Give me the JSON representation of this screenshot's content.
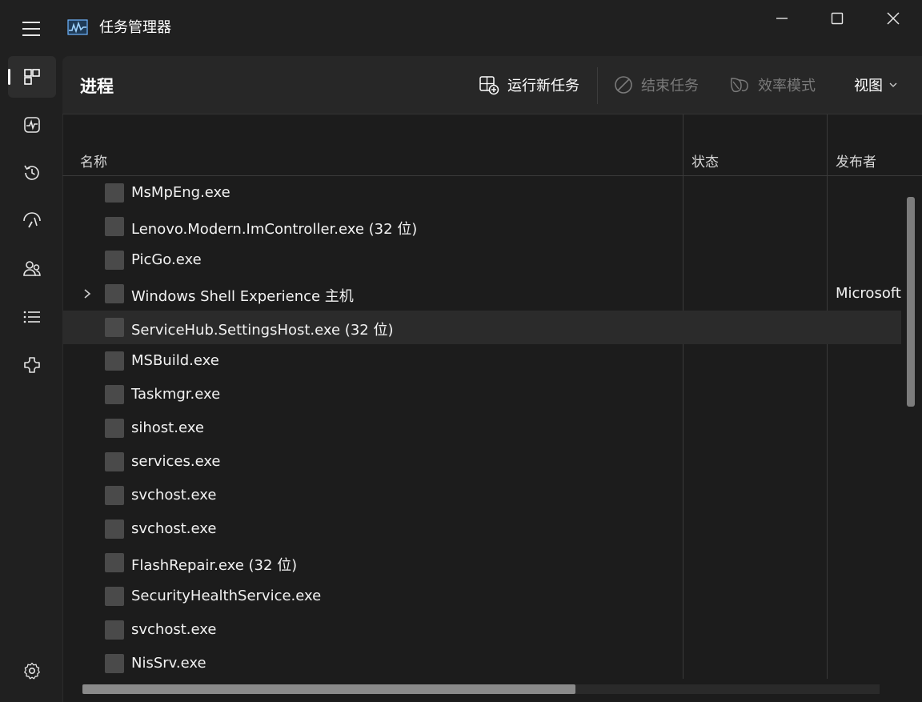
{
  "window": {
    "title": "任务管理器",
    "controls": {
      "minimize": "minimize",
      "maximize": "maximize",
      "close": "close"
    }
  },
  "nav": {
    "items": [
      {
        "name": "processes",
        "icon": "processes-icon",
        "active": true
      },
      {
        "name": "performance",
        "icon": "performance-icon",
        "active": false
      },
      {
        "name": "app-history",
        "icon": "history-icon",
        "active": false
      },
      {
        "name": "startup-apps",
        "icon": "startup-icon",
        "active": false
      },
      {
        "name": "users",
        "icon": "users-icon",
        "active": false
      },
      {
        "name": "details",
        "icon": "details-icon",
        "active": false
      },
      {
        "name": "services",
        "icon": "services-icon",
        "active": false
      }
    ],
    "settings_icon": "settings-icon"
  },
  "toolbar": {
    "page_title": "进程",
    "run_new_task": "运行新任务",
    "end_task": "结束任务",
    "efficiency_mode": "效率模式",
    "view": "视图"
  },
  "table": {
    "columns": {
      "name": "名称",
      "status": "状态",
      "publisher": "发布者"
    },
    "rows": [
      {
        "name": "MsMpEng.exe",
        "publisher": "",
        "expandable": false
      },
      {
        "name": "Lenovo.Modern.ImController.exe (32 位)",
        "publisher": "",
        "expandable": false
      },
      {
        "name": "PicGo.exe",
        "publisher": "",
        "expandable": false
      },
      {
        "name": "Windows Shell Experience 主机",
        "publisher": "Microsoft",
        "expandable": true
      },
      {
        "name": "ServiceHub.SettingsHost.exe (32 位)",
        "publisher": "",
        "expandable": false,
        "highlighted": true
      },
      {
        "name": "MSBuild.exe",
        "publisher": "",
        "expandable": false
      },
      {
        "name": "Taskmgr.exe",
        "publisher": "",
        "expandable": false
      },
      {
        "name": "sihost.exe",
        "publisher": "",
        "expandable": false
      },
      {
        "name": "services.exe",
        "publisher": "",
        "expandable": false
      },
      {
        "name": "svchost.exe",
        "publisher": "",
        "expandable": false
      },
      {
        "name": "svchost.exe",
        "publisher": "",
        "expandable": false
      },
      {
        "name": "FlashRepair.exe (32 位)",
        "publisher": "",
        "expandable": false
      },
      {
        "name": "SecurityHealthService.exe",
        "publisher": "",
        "expandable": false
      },
      {
        "name": "svchost.exe",
        "publisher": "",
        "expandable": false
      },
      {
        "name": "NisSrv.exe",
        "publisher": "",
        "expandable": false
      }
    ]
  },
  "colors": {
    "background": "#202020",
    "panel": "#1c1c1c",
    "toolbar": "#272727",
    "row_highlight": "#2b2b2b",
    "text": "#ffffff",
    "disabled": "#7a7a7a"
  }
}
